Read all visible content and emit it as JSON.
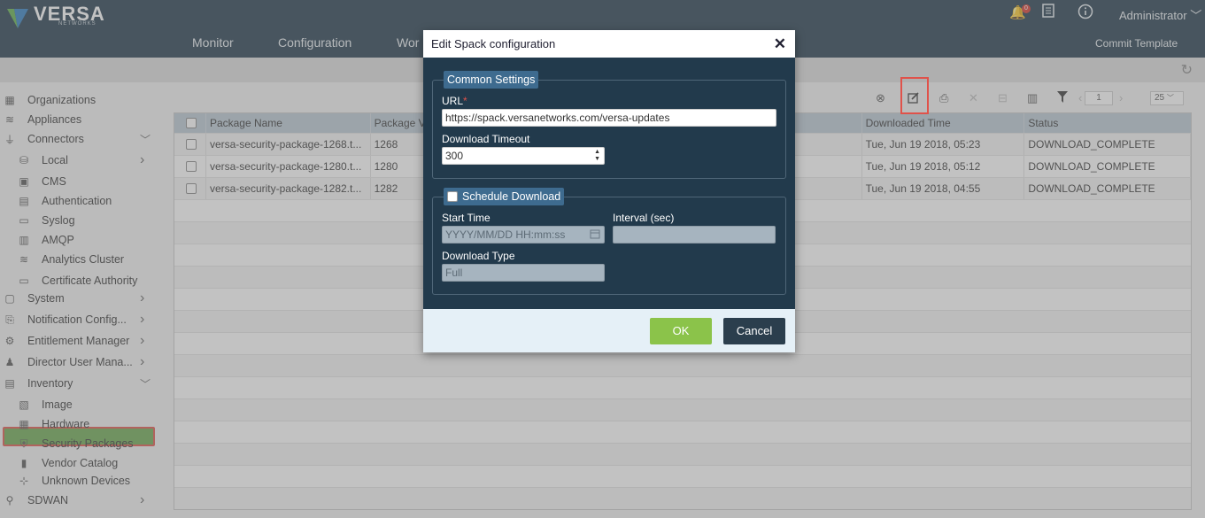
{
  "header": {
    "logo_text": "VERSA",
    "logo_sub": "NETWORKS",
    "nav": [
      "Monitor",
      "Configuration",
      "Wor"
    ],
    "notification_count": "0",
    "user": "Administrator",
    "commit_label": "Commit Template"
  },
  "sidebar": {
    "items": [
      {
        "label": "Organizations",
        "icon": "org-icon"
      },
      {
        "label": "Appliances",
        "icon": "appliances-icon"
      },
      {
        "label": "Connectors",
        "icon": "connector-icon",
        "chev": "down"
      },
      {
        "label": "Local",
        "icon": "local-icon",
        "chev": "right"
      },
      {
        "label": "CMS",
        "icon": "cms-icon"
      },
      {
        "label": "Authentication",
        "icon": "auth-icon"
      },
      {
        "label": "Syslog",
        "icon": "syslog-icon"
      },
      {
        "label": "AMQP",
        "icon": "amqp-icon"
      },
      {
        "label": "Analytics Cluster",
        "icon": "analytics-icon"
      },
      {
        "label": "Certificate Authority",
        "icon": "certificate-icon"
      },
      {
        "label": "System",
        "icon": "system-icon",
        "chev": "right"
      },
      {
        "label": "Notification Config...",
        "icon": "notification-icon",
        "chev": "right"
      },
      {
        "label": "Entitlement Manager",
        "icon": "entitlement-icon",
        "chev": "right"
      },
      {
        "label": "Director User Mana...",
        "icon": "users-icon",
        "chev": "right"
      },
      {
        "label": "Inventory",
        "icon": "inventory-icon",
        "chev": "down"
      },
      {
        "label": "Image",
        "icon": "image-icon"
      },
      {
        "label": "Hardware",
        "icon": "hardware-icon"
      },
      {
        "label": "Security Packages",
        "icon": "shield-icon"
      },
      {
        "label": "Vendor Catalog",
        "icon": "catalog-icon"
      },
      {
        "label": "Unknown Devices",
        "icon": "devices-icon"
      },
      {
        "label": "SDWAN",
        "icon": "sdwan-icon",
        "chev": "right"
      }
    ]
  },
  "toolbar": {
    "page": "1",
    "page_size": "25"
  },
  "table": {
    "columns": [
      "Package Name",
      "Package V",
      "Downloaded Time",
      "Status"
    ],
    "rows": [
      {
        "name": "versa-security-package-1268.t...",
        "version": "1268",
        "time": "Tue, Jun 19 2018, 05:23",
        "status": "DOWNLOAD_COMPLETE"
      },
      {
        "name": "versa-security-package-1280.t...",
        "version": "1280",
        "time": "Tue, Jun 19 2018, 05:12",
        "status": "DOWNLOAD_COMPLETE"
      },
      {
        "name": "versa-security-package-1282.t...",
        "version": "1282",
        "time": "Tue, Jun 19 2018, 04:55",
        "status": "DOWNLOAD_COMPLETE"
      }
    ]
  },
  "modal": {
    "title": "Edit Spack configuration",
    "common_settings": "Common Settings",
    "url_label": "URL",
    "url_required": "*",
    "url_value": "https://spack.versanetworks.com/versa-updates",
    "timeout_label": "Download Timeout",
    "timeout_value": "300",
    "schedule_label": "Schedule Download",
    "start_time_label": "Start Time",
    "start_time_placeholder": "YYYY/MM/DD HH:mm:ss",
    "interval_label": "Interval (sec)",
    "download_type_label": "Download Type",
    "download_type_value": "Full",
    "ok_label": "OK",
    "cancel_label": "Cancel"
  }
}
